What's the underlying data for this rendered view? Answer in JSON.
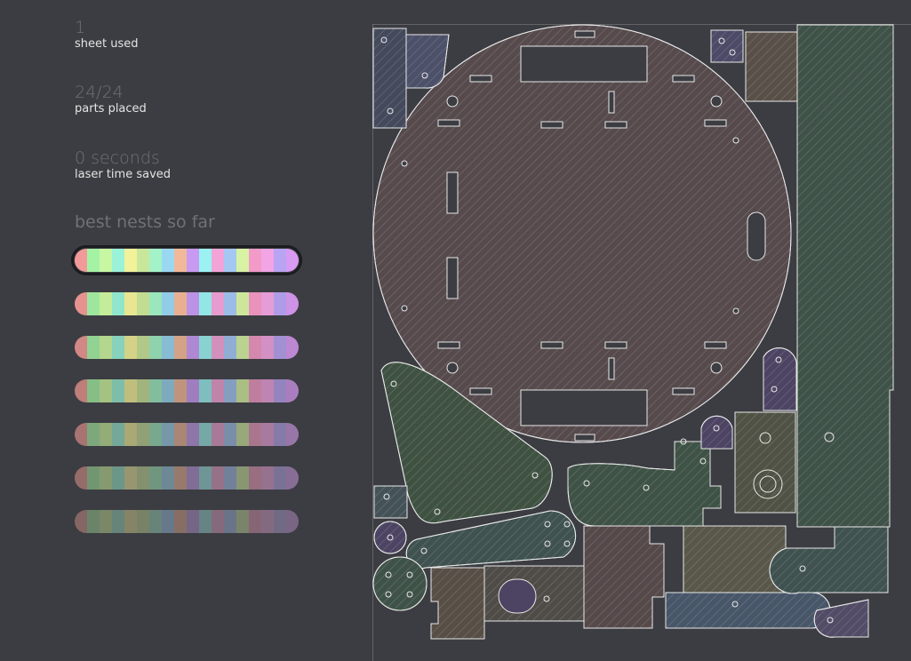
{
  "stats": [
    {
      "value": "1",
      "label": "sheet used"
    },
    {
      "value": "24/24",
      "label": "parts placed"
    },
    {
      "value": "0 seconds",
      "label": "laser time saved"
    }
  ],
  "best_title": "best nests so far",
  "nests": [
    {
      "selected": true,
      "colors": [
        "#f29a9a",
        "#a4f2a4",
        "#c8f7a4",
        "#9af2d8",
        "#f2f29a",
        "#c8e79a",
        "#a4f2c8",
        "#9ad8f2",
        "#f2b89a",
        "#c89af2",
        "#9af2f2",
        "#f2a4d8",
        "#a4c8f2",
        "#d8f2a4",
        "#f29ac8",
        "#f2a4e4",
        "#b8a4f2",
        "#d89af2"
      ]
    },
    {
      "selected": false,
      "colors": [
        "#e6938f",
        "#9ee69e",
        "#c4ec9a",
        "#90e6cc",
        "#e8e690",
        "#c2dc92",
        "#9ae6bd",
        "#92cce6",
        "#e8b090",
        "#bc92e6",
        "#92e6e6",
        "#e69cce",
        "#9cbce8",
        "#cee69c",
        "#e892bc",
        "#e69cd6",
        "#b09ce6",
        "#ce92e6"
      ]
    },
    {
      "selected": false,
      "colors": [
        "#d28884",
        "#92d292",
        "#b4d68e",
        "#86d2bc",
        "#d4d286",
        "#b2c888",
        "#8ed2ae",
        "#88bcd2",
        "#d4a286",
        "#ae88d2",
        "#88d2d2",
        "#d290bc",
        "#90aed4",
        "#bcd290",
        "#d488ae",
        "#d290c4",
        "#a290d2",
        "#bc88d2"
      ]
    },
    {
      "selected": false,
      "colors": [
        "#be7e7a",
        "#86be86",
        "#a4c282",
        "#7cbeaa",
        "#c0be7c",
        "#a2b47e",
        "#82be9e",
        "#7eaabe",
        "#c0947c",
        "#9e7ebe",
        "#7ebebe",
        "#be84aa",
        "#849ec0",
        "#aabe84",
        "#c07e9e",
        "#be84b2",
        "#9484be",
        "#aa7ebe"
      ]
    },
    {
      "selected": false,
      "colors": [
        "#a87472",
        "#7ca87c",
        "#94ac78",
        "#74a898",
        "#aaa874",
        "#92a076",
        "#78a88e",
        "#7698a8",
        "#aa8674",
        "#8e76a8",
        "#76a8a8",
        "#a87a98",
        "#7a8eaa",
        "#98a87a",
        "#aa768e",
        "#a87aa0",
        "#867aa8",
        "#9876a8"
      ]
    },
    {
      "selected": false,
      "colors": [
        "#966c6a",
        "#729672",
        "#869a70",
        "#6c9688",
        "#989670",
        "#84906e",
        "#709680",
        "#6e8896",
        "#987a6c",
        "#806e96",
        "#6e9696",
        "#967288",
        "#72809a",
        "#889672",
        "#986e80",
        "#96728e",
        "#7a7296",
        "#886e96"
      ]
    },
    {
      "selected": false,
      "colors": [
        "#846664",
        "#6a846a",
        "#7a8868",
        "#66847a",
        "#868466",
        "#788266",
        "#68847a",
        "#66788a",
        "#866e64",
        "#746684",
        "#668484",
        "#846a7a",
        "#6a7488",
        "#7a846a",
        "#866674",
        "#846a80",
        "#706a84",
        "#7a6684"
      ]
    }
  ]
}
